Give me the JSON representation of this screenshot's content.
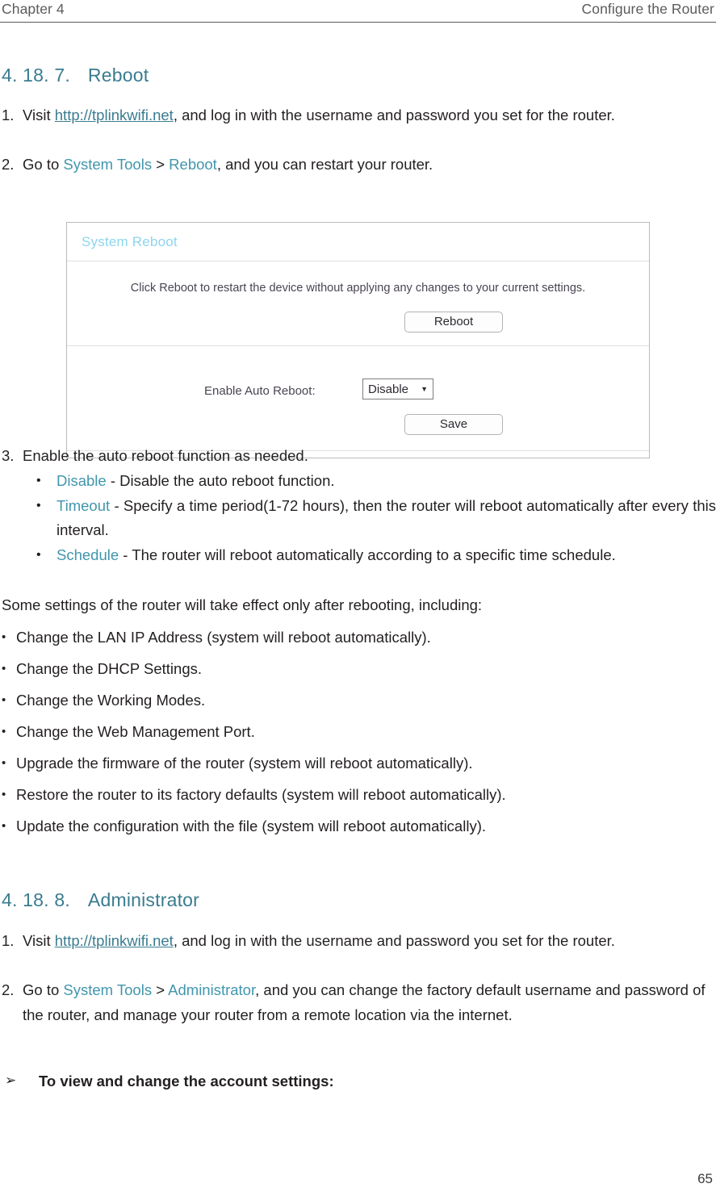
{
  "runhead": {
    "left": "Chapter 4",
    "right": "Configure the Router"
  },
  "sections": {
    "reboot": {
      "number": "4. 18. 7.",
      "title": "Reboot",
      "step1": {
        "marker": "1.",
        "pre": "Visit ",
        "link": "http://tplinkwifi.net",
        "post": ", and log in with the username and password you set for the router."
      },
      "step2": {
        "marker": "2.",
        "pre": "Go to ",
        "nav1": "System Tools",
        "sep": " > ",
        "nav2": "Reboot",
        "post": ", and you can restart your router."
      },
      "step3": {
        "marker": "3.",
        "text": "Enable the auto reboot function as needed."
      },
      "options": [
        {
          "bullet": "•",
          "term": "Disable",
          "desc": " - Disable the auto reboot function."
        },
        {
          "bullet": "•",
          "term": "Timeout",
          "desc": " - Specify a time period(1-72 hours), then the router will reboot automatically after every this interval."
        },
        {
          "bullet": "•",
          "term": "Schedule",
          "desc": " - The router will reboot automatically according to a specific time schedule."
        }
      ],
      "note_intro": "Some settings of the router will take effect only after rebooting, including:",
      "note_items": [
        "Change the LAN IP Address (system will reboot automatically).",
        "Change the DHCP Settings.",
        "Change the Working Modes.",
        "Change the Web Management Port.",
        "Upgrade the firmware of the router (system will reboot automatically).",
        "Restore the router to its factory defaults (system will reboot automatically).",
        "Update the configuration with the file (system will reboot automatically)."
      ],
      "note_bullet": "•"
    },
    "administrator": {
      "number": "4. 18. 8.",
      "title": "Administrator",
      "step1": {
        "marker": "1.",
        "pre": "Visit ",
        "link": "http://tplinkwifi.net",
        "post": ", and log in with the username and password you set for the router."
      },
      "step2": {
        "marker": "2.",
        "pre": "Go to ",
        "nav1": "System Tools",
        "sep": " > ",
        "nav2": "Administrator",
        "post": ", and you can change the factory default username and password of the router, and manage your router from a remote location via the internet."
      },
      "arrow": {
        "glyph": "➢",
        "text": "To view and change the account settings:"
      }
    }
  },
  "router_ui": {
    "panel_title": "System Reboot",
    "description": "Click Reboot to restart the device without applying any changes to your current settings.",
    "reboot_button": "Reboot",
    "field_label": "Enable Auto Reboot:",
    "select_value": "Disable",
    "select_caret": "▼",
    "save_button": "Save",
    "title_color": "#8dd5ef"
  },
  "footer": {
    "page_number": "65"
  }
}
